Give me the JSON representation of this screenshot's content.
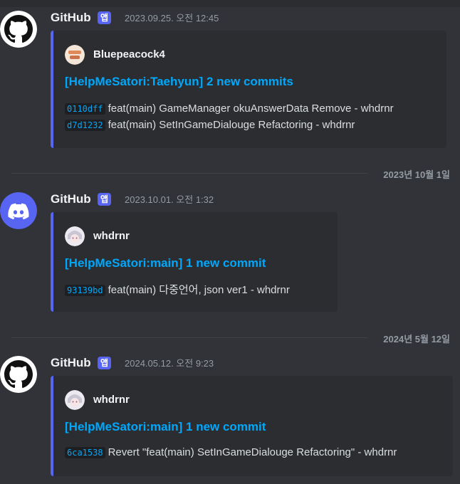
{
  "messages": [
    {
      "author": "GitHub",
      "badge": "앱",
      "timestamp": "2023.09.25. 오전 12:45",
      "avatar_icon": "github-icon",
      "embed": {
        "author": "Bluepeacock4",
        "title": "[HelpMeSatori:Taehyun] 2 new commits",
        "commits": [
          {
            "hash": "0110dff",
            "text": "feat(main) GameManager okuAnswerData Remove - whdrnr"
          },
          {
            "hash": "d7d1232",
            "text": "feat(main) SetInGameDialouge Refactoring - whdrnr"
          }
        ]
      }
    },
    {
      "author": "GitHub",
      "badge": "앱",
      "timestamp": "2023.10.01. 오전 1:32",
      "avatar_icon": "discord-icon",
      "embed": {
        "author": "whdrnr",
        "title": "[HelpMeSatori:main] 1 new commit",
        "commits": [
          {
            "hash": "93139bd",
            "text": "feat(main) 다중언어, json ver1 - whdrnr"
          }
        ]
      }
    },
    {
      "author": "GitHub",
      "badge": "앱",
      "timestamp": "2024.05.12. 오전 9:23",
      "avatar_icon": "github-icon",
      "embed": {
        "author": "whdrnr",
        "title": "[HelpMeSatori:main] 1 new commit",
        "commits": [
          {
            "hash": "6ca1538",
            "text": "Revert \"feat(main) SetInGameDialouge Refactoring\" - whdrnr"
          }
        ]
      }
    }
  ],
  "dividers": [
    "2023년 10월 1일",
    "2024년 5월 12일"
  ],
  "colors": {
    "background": "#313338",
    "embed_background": "#2b2d31",
    "embed_border": "#5865f2",
    "link": "#00a8fc",
    "badge": "#5865f2"
  }
}
